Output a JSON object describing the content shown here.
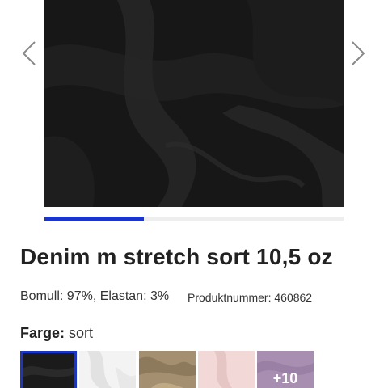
{
  "product": {
    "title": "Denim m stretch sort 10,5 oz",
    "composition": "Bomull: 97%, Elastan: 3%",
    "product_number": "Produktnummer: 460862"
  },
  "gallery": {
    "image_icon": "fabric-photo",
    "prev_icon": "chevron-left-icon",
    "next_icon": "chevron-right-icon",
    "progress": 0.333,
    "progress_color": "#1a35c9"
  },
  "color_selector": {
    "label": "Farge:",
    "selected_value": "sort",
    "more_count": "+10",
    "swatches": [
      {
        "color": "#1b1b1b",
        "selected": true
      },
      {
        "color": "#f3f3f3",
        "selected": false
      },
      {
        "color": "#a48f70",
        "selected": false
      },
      {
        "color": "#f2d9d8",
        "selected": false
      },
      {
        "color": "#a88fb2",
        "selected": false
      }
    ]
  },
  "colors": {
    "accent": "#1a35c9",
    "text": "#222222"
  }
}
